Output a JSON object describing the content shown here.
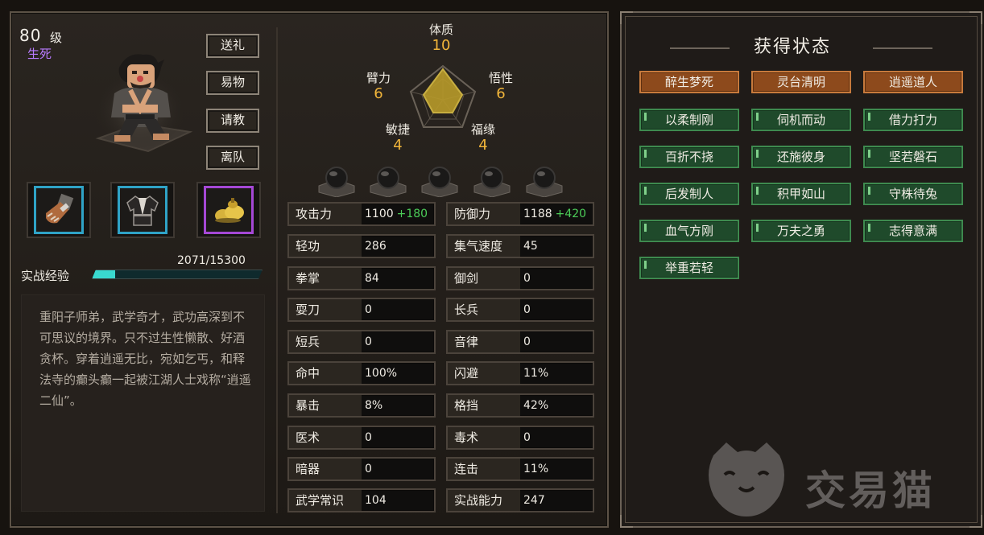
{
  "character": {
    "level": "80",
    "level_unit": "级",
    "name": "生死"
  },
  "actions": [
    "送礼",
    "易物",
    "请教",
    "离队"
  ],
  "equipment": [
    {
      "icon": "gauntlet-icon",
      "rarity": "blue"
    },
    {
      "icon": "robe-icon",
      "rarity": "blue"
    },
    {
      "icon": "gold-gourd-icon",
      "rarity": "purple"
    }
  ],
  "experience": {
    "label": "实战经验",
    "text": "2071/15300",
    "progress": 0.135
  },
  "description": "重阳子师弟，武学奇才，武功高深到不可思议的境界。只不过生性懒散、好酒贪杯。穿着逍遥无比，宛如乞丐，和释法寺的癫头癫一起被江湖人士戏称“逍遥二仙”。",
  "attributes": {
    "tizhi": {
      "label": "体质",
      "value": "10"
    },
    "wuxing": {
      "label": "悟性",
      "value": "6"
    },
    "fuyuan": {
      "label": "福缘",
      "value": "4"
    },
    "minjie": {
      "label": "敏捷",
      "value": "4"
    },
    "bili": {
      "label": "臂力",
      "value": "6"
    }
  },
  "stats": {
    "left": [
      {
        "name": "攻击力",
        "value": "1100",
        "bonus": "+180"
      },
      {
        "name": "轻功",
        "value": "286"
      },
      {
        "name": "拳掌",
        "value": "84"
      },
      {
        "name": "耍刀",
        "value": "0"
      },
      {
        "name": "短兵",
        "value": "0"
      },
      {
        "name": "命中",
        "value": "100%"
      },
      {
        "name": "暴击",
        "value": "8%"
      },
      {
        "name": "医术",
        "value": "0"
      },
      {
        "name": "暗器",
        "value": "0"
      },
      {
        "name": "武学常识",
        "value": "104"
      }
    ],
    "right": [
      {
        "name": "防御力",
        "value": "1188",
        "bonus": "+420"
      },
      {
        "name": "集气速度",
        "value": "45"
      },
      {
        "name": "御剑",
        "value": "0"
      },
      {
        "name": "长兵",
        "value": "0"
      },
      {
        "name": "音律",
        "value": "0"
      },
      {
        "name": "闪避",
        "value": "11%"
      },
      {
        "name": "格挡",
        "value": "42%"
      },
      {
        "name": "毒术",
        "value": "0"
      },
      {
        "name": "连击",
        "value": "11%"
      },
      {
        "name": "实战能力",
        "value": "247"
      }
    ]
  },
  "status_panel": {
    "title": "获得状态",
    "tags": [
      {
        "label": "醉生梦死",
        "color": "orange"
      },
      {
        "label": "灵台清明",
        "color": "orange"
      },
      {
        "label": "逍遥道人",
        "color": "orange"
      },
      {
        "label": "以柔制刚",
        "color": "green"
      },
      {
        "label": "伺机而动",
        "color": "green"
      },
      {
        "label": "借力打力",
        "color": "green"
      },
      {
        "label": "百折不挠",
        "color": "green"
      },
      {
        "label": "还施彼身",
        "color": "green"
      },
      {
        "label": "坚若磐石",
        "color": "green"
      },
      {
        "label": "后发制人",
        "color": "green"
      },
      {
        "label": "积甲如山",
        "color": "green"
      },
      {
        "label": "守株待兔",
        "color": "green"
      },
      {
        "label": "血气方刚",
        "color": "green"
      },
      {
        "label": "万夫之勇",
        "color": "green"
      },
      {
        "label": "志得意满",
        "color": "green"
      },
      {
        "label": "举重若轻",
        "color": "green"
      }
    ]
  },
  "watermark": {
    "text": "交易猫",
    "icon": "cat-logo-icon"
  },
  "colors": {
    "attr_value": "#f0b43a",
    "bonus": "#4ccd58",
    "exp_fill": "#39d9cf",
    "name_purple": "#b87bff",
    "tag_orange": "#8d4a1c",
    "tag_green": "#1f4a2b"
  }
}
